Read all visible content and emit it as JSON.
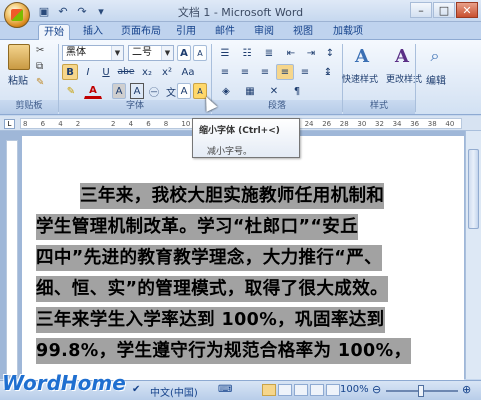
{
  "window": {
    "title": "文档 1 - Microsoft Word"
  },
  "qat": {
    "save_icon": "save-icon",
    "undo_icon": "undo-icon",
    "redo_icon": "redo-icon",
    "customize_icon": "customize-icon"
  },
  "tabs": [
    {
      "label": "开始",
      "active": true
    },
    {
      "label": "插入"
    },
    {
      "label": "页面布局"
    },
    {
      "label": "引用"
    },
    {
      "label": "邮件"
    },
    {
      "label": "审阅"
    },
    {
      "label": "视图"
    },
    {
      "label": "加载项"
    }
  ],
  "ribbon": {
    "clipboard": {
      "paste": "粘贴",
      "group": "剪贴板"
    },
    "font": {
      "font_name": "黑体",
      "font_size": "二号",
      "bold": "B",
      "italic": "I",
      "underline": "U",
      "strike": "abe",
      "subscript": "x₂",
      "superscript": "x²",
      "grow": "A",
      "shrink": "A",
      "text_color": "A",
      "char_shading": "A",
      "char_border": "A",
      "phonetic": "wén",
      "group": "字体"
    },
    "paragraph": {
      "group": "段落"
    },
    "styles": {
      "quick": "快速样式",
      "change": "更改样式",
      "group": "样式"
    },
    "editing": {
      "label": "编辑"
    }
  },
  "tooltip": {
    "title": "缩小字体 (Ctrl+<)",
    "body": "减小字号。"
  },
  "ruler": {
    "numbers": [
      "8",
      "6",
      "4",
      "2",
      "",
      "2",
      "4",
      "6",
      "8",
      "10",
      "12",
      "14",
      "16",
      "18",
      "20",
      "22",
      "24",
      "26",
      "28",
      "30",
      "32",
      "34",
      "36",
      "38",
      "40"
    ]
  },
  "document": {
    "lines": [
      "三年来，我校大胆实施教师任用机制和",
      "学生管理机制改革。学习“杜郎口”“安丘",
      "四中”先进的教育教学理念，大力推行“严、",
      "细、恒、实”的管理模式，取得了很大成效。",
      "三年来学生入学率达到 100%，巩固率达到",
      "99.8%，学生遵守行为规范合格率为 100%，"
    ],
    "selection_color": "#a2a2a2"
  },
  "statusbar": {
    "watermark": "WordHome",
    "language": "中文(中国)",
    "zoom": "100%"
  }
}
